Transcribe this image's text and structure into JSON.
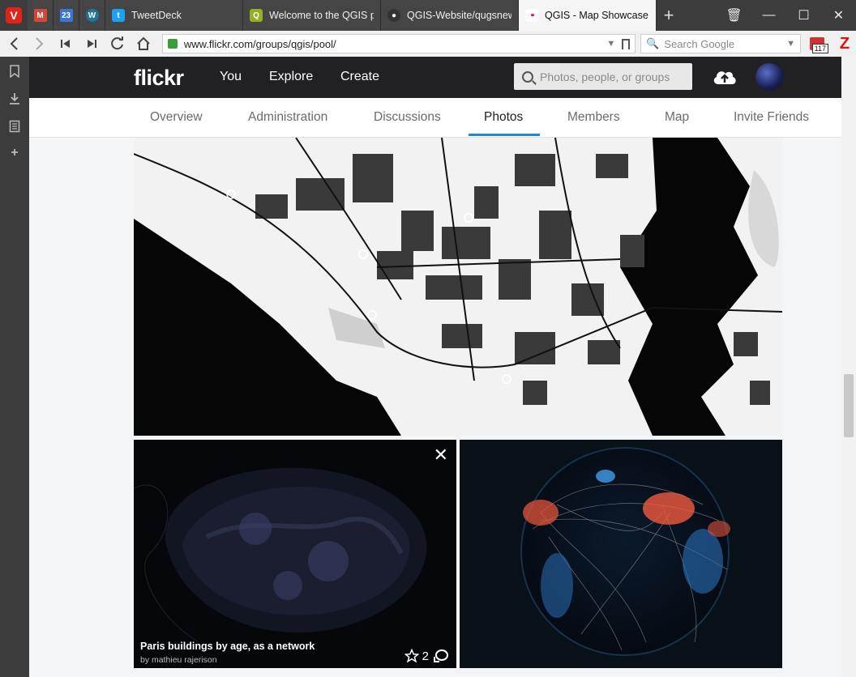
{
  "browser": {
    "pinned_tabs": [
      {
        "name": "gmail",
        "icon": "gmail-icon",
        "glyph": "M",
        "color": "#d44638"
      },
      {
        "name": "calendar",
        "icon": "calendar-icon",
        "glyph": "23",
        "color": "#3b73d6"
      },
      {
        "name": "wordpress",
        "icon": "wordpress-icon",
        "glyph": "W",
        "color": "#21759b"
      }
    ],
    "tabs": [
      {
        "title": "TweetDeck",
        "icon": "twitter-icon",
        "glyph": "t",
        "color": "#1da1f2",
        "active": false
      },
      {
        "title": "Welcome to the QGIS pro",
        "icon": "qgis-icon",
        "glyph": "Q",
        "color": "#93b023",
        "active": false
      },
      {
        "title": "QGIS-Website/qugsnews.",
        "icon": "github-icon",
        "glyph": "●",
        "color": "#333333",
        "active": false
      },
      {
        "title": "QGIS - Map Showcase | Fl",
        "icon": "flickr-icon",
        "glyph": "••",
        "color": "#ffffff",
        "active": true
      }
    ],
    "new_tab_label": "+",
    "address": {
      "url": "www.flickr.com/groups/qgis/pool/",
      "search_placeholder": "Search Google"
    },
    "extension_badge": "117",
    "zotero_label": "Z",
    "window_controls": {
      "trash": "🗑",
      "minimize": "—",
      "maximize": "☐",
      "close": "✕"
    }
  },
  "side_panel": [
    "bookmark-icon",
    "download-icon",
    "notes-icon",
    "add-panel-icon"
  ],
  "flickr": {
    "logo": "flickr",
    "nav": {
      "you": "You",
      "explore": "Explore",
      "create": "Create"
    },
    "search_placeholder": "Photos, people, or groups",
    "tabs": [
      "Overview",
      "Administration",
      "Discussions",
      "Photos",
      "Members",
      "Map",
      "Invite Friends"
    ],
    "selected_tab": "Photos",
    "photos": [
      {
        "kind": "map",
        "description": "black and white city map"
      },
      {
        "kind": "paris",
        "title": "Paris buildings by age, as a network",
        "author_prefix": "by",
        "author": "mathieu rajerison",
        "favorites": "2"
      },
      {
        "kind": "globe"
      }
    ]
  },
  "colors": {
    "flickr_header": "#212124",
    "accent_underline": "#1f8ad4",
    "vivaldi_red": "#e2231a"
  }
}
